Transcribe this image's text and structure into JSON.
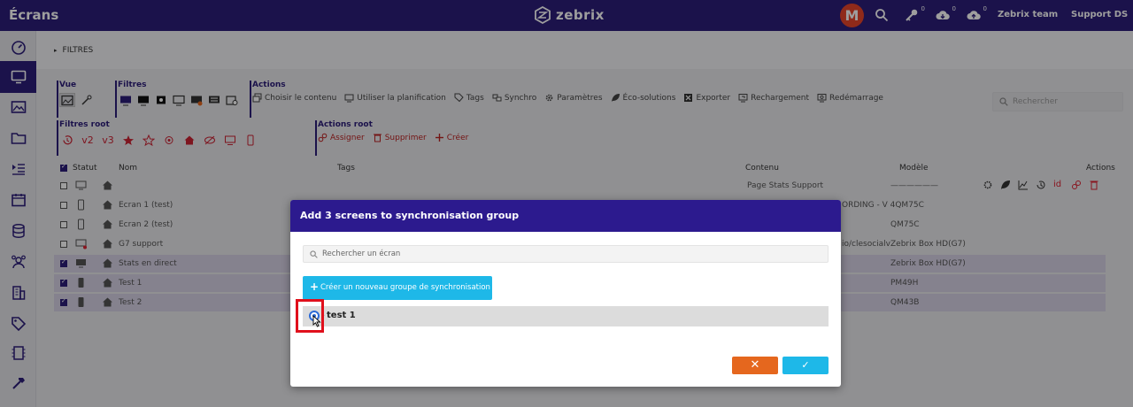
{
  "app": {
    "title": "Écrans",
    "brand": "zebrix",
    "avatar_letter": "M",
    "user": "Zebrix team",
    "support": "Support DS"
  },
  "topbar_badges": {
    "key": "0",
    "cloud_down": "0",
    "cloud_up": "0"
  },
  "filters_label": "FILTRES",
  "toolbar": {
    "vue_title": "Vue",
    "filtres_title": "Filtres",
    "actions_title": "Actions",
    "actions": [
      "Choisir le contenu",
      "Utiliser la planification",
      "Tags",
      "Synchro",
      "Paramètres",
      "Éco-solutions",
      "Exporter",
      "Rechargement",
      "Redémarrage"
    ],
    "filtres_root_title": "Filtres root",
    "filtres_root_text": [
      "v2",
      "v3"
    ],
    "actions_root_title": "Actions root",
    "actions_root": [
      "Assigner",
      "Supprimer",
      "Créer"
    ],
    "search_placeholder": "Rechercher"
  },
  "table": {
    "headers": {
      "status": "Statut",
      "name": "Nom",
      "tags": "Tags",
      "content": "Contenu",
      "model": "Modèle",
      "actions": "Actions"
    },
    "rows": [
      {
        "name": "",
        "content": "Page Stats Support",
        "model": "——————",
        "selected": false
      },
      {
        "name": "Ecran 1 (test)",
        "content": "",
        "model": "ORDING - V 4QM75C",
        "selected": false
      },
      {
        "name": "Ecran 2 (test)",
        "content": "",
        "model": "QM75C",
        "selected": false
      },
      {
        "name": "G7 support",
        "content": "",
        "model": "io/clesocialvZebrix Box HD(G7)",
        "selected": false
      },
      {
        "name": "Stats en direct",
        "content": "",
        "model": "Zebrix Box HD(G7)",
        "selected": true
      },
      {
        "name": "Test 1",
        "content": "",
        "model": "PM49H",
        "selected": true
      },
      {
        "name": "Test 2",
        "content": "",
        "model": "QM43B",
        "selected": true
      }
    ]
  },
  "modal": {
    "title": "Add 3 screens to synchronisation group",
    "search_placeholder": "Rechercher un écran",
    "create_label": "Créer un nouveau groupe de synchronisation",
    "group_name": "test 1",
    "cancel_label": "✕",
    "ok_label": "✓"
  },
  "colors": {
    "header": "#2c1d7a",
    "modal_header": "#2c1a8e",
    "accent": "#1eb8e8",
    "cancel": "#e5671e",
    "highlight": "#e0101c"
  }
}
